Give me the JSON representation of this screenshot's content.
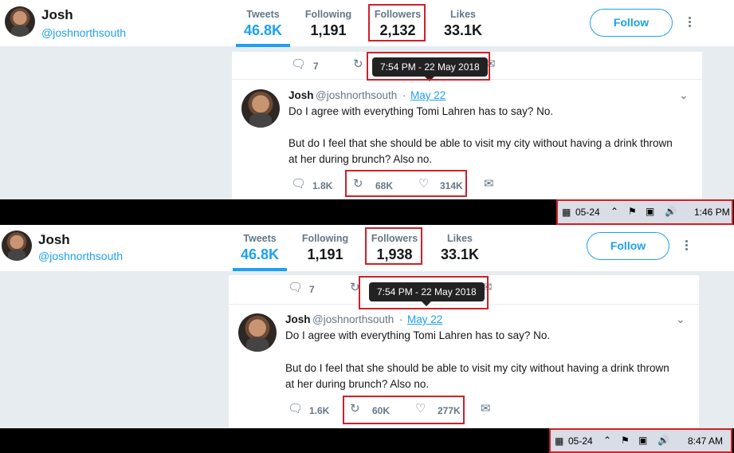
{
  "profile": {
    "name": "Josh",
    "handle": "@joshnorthsouth",
    "follow_label": "Follow"
  },
  "snapshots": [
    {
      "stats": [
        {
          "label": "Tweets",
          "value": "46.8K"
        },
        {
          "label": "Following",
          "value": "1,191"
        },
        {
          "label": "Followers",
          "value": "2,132"
        },
        {
          "label": "Likes",
          "value": "33.1K"
        }
      ],
      "prev_reply_count": "7",
      "tooltip": "7:54 PM - 22 May 2018",
      "tweet": {
        "name": "Josh",
        "handle": "@joshnorthsouth",
        "sep": "·",
        "date": "May 22",
        "line1": "Do I agree with everything Tomi Lahren has to say? No.",
        "line2": "But do I feel that she should be able to visit my city without having a drink thrown",
        "line3": "at her during brunch? Also no.",
        "replies": "1.8K",
        "retweets": "68K",
        "likes": "314K"
      },
      "taskbar": {
        "date": "05-24",
        "time": "1:46 PM"
      }
    },
    {
      "stats": [
        {
          "label": "Tweets",
          "value": "46.8K"
        },
        {
          "label": "Following",
          "value": "1,191"
        },
        {
          "label": "Followers",
          "value": "1,938"
        },
        {
          "label": "Likes",
          "value": "33.1K"
        }
      ],
      "prev_reply_count": "7",
      "tooltip": "7:54 PM - 22 May 2018",
      "tweet": {
        "name": "Josh",
        "handle": "@joshnorthsouth",
        "sep": "·",
        "date": "May 22",
        "line1": "Do I agree with everything Tomi Lahren has to say? No.",
        "line2": "But do I feel that she should be able to visit my city without having a drink thrown",
        "line3": "at her during brunch? Also no.",
        "replies": "1.6K",
        "retweets": "60K",
        "likes": "277K"
      },
      "taskbar": {
        "date": "05-24",
        "time": "8:47 AM"
      }
    }
  ],
  "icons": {
    "reply": "reply-icon",
    "retweet": "retweet-icon",
    "like": "heart-icon",
    "dm": "envelope-icon",
    "chevron": "chevron-down-icon"
  },
  "colors": {
    "accent": "#1da1f2",
    "highlight": "#d0202a"
  }
}
